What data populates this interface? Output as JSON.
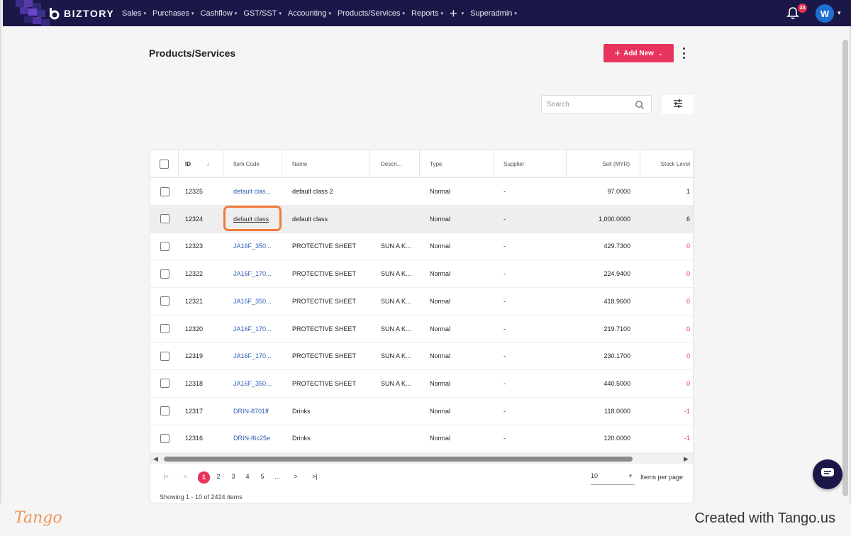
{
  "app": {
    "brand": "BIZTORY",
    "menu": [
      {
        "label": "Sales"
      },
      {
        "label": "Purchases"
      },
      {
        "label": "Cashflow"
      },
      {
        "label": "GST/SST"
      },
      {
        "label": "Accounting"
      },
      {
        "label": "Products/Services"
      },
      {
        "label": "Reports"
      }
    ],
    "plus_label": "+",
    "superadmin": "Superadmin",
    "notification_count": "24",
    "avatar_initial": "W",
    "accent_color": "#e8345c",
    "nav_color": "#1b1849"
  },
  "page": {
    "title": "Products/Services",
    "add_button": "Add New",
    "search_placeholder": "Search"
  },
  "table": {
    "headers": {
      "id": "ID",
      "item_code": "Item Code",
      "name": "Name",
      "description": "Descri...",
      "type": "Type",
      "supplier": "Supplier",
      "sell": "Sell (MYR)",
      "stock": "Stock Level"
    },
    "rows": [
      {
        "id": "12325",
        "item_code": "default clas...",
        "name": "default class 2",
        "description": "",
        "type": "Normal",
        "supplier": "-",
        "sell": "97.0000",
        "stock": "1",
        "negative": false,
        "highlight": false
      },
      {
        "id": "12324",
        "item_code": "default class",
        "name": "default class",
        "description": "",
        "type": "Normal",
        "supplier": "-",
        "sell": "1,000.0000",
        "stock": "6",
        "negative": false,
        "highlight": true
      },
      {
        "id": "12323",
        "item_code": "JA16F_350...",
        "name": "PROTECTIVE SHEET",
        "description": "SUN A K...",
        "type": "Normal",
        "supplier": "-",
        "sell": "429.7300",
        "stock": "0",
        "negative": true,
        "highlight": false
      },
      {
        "id": "12322",
        "item_code": "JA16F_170...",
        "name": "PROTECTIVE SHEET",
        "description": "SUN A K...",
        "type": "Normal",
        "supplier": "-",
        "sell": "224.9400",
        "stock": "0",
        "negative": true,
        "highlight": false
      },
      {
        "id": "12321",
        "item_code": "JA16F_350...",
        "name": "PROTECTIVE SHEET",
        "description": "SUN A K...",
        "type": "Normal",
        "supplier": "-",
        "sell": "418.9600",
        "stock": "0",
        "negative": true,
        "highlight": false
      },
      {
        "id": "12320",
        "item_code": "JA16F_170...",
        "name": "PROTECTIVE SHEET",
        "description": "SUN A K...",
        "type": "Normal",
        "supplier": "-",
        "sell": "219.7100",
        "stock": "0",
        "negative": true,
        "highlight": false
      },
      {
        "id": "12319",
        "item_code": "JA16F_170...",
        "name": "PROTECTIVE SHEET",
        "description": "SUN A K...",
        "type": "Normal",
        "supplier": "-",
        "sell": "230.1700",
        "stock": "0",
        "negative": true,
        "highlight": false
      },
      {
        "id": "12318",
        "item_code": "JA16F_350...",
        "name": "PROTECTIVE SHEET",
        "description": "SUN A K...",
        "type": "Normal",
        "supplier": "-",
        "sell": "440.5000",
        "stock": "0",
        "negative": true,
        "highlight": false
      },
      {
        "id": "12317",
        "item_code": "DRIN-8701ff",
        "name": "Drinks",
        "description": "",
        "type": "Normal",
        "supplier": "-",
        "sell": "118.0000",
        "stock": "-1",
        "negative": true,
        "highlight": false
      },
      {
        "id": "12316",
        "item_code": "DRIN-f6c25e",
        "name": "Drinks",
        "description": "",
        "type": "Normal",
        "supplier": "-",
        "sell": "120.0000",
        "stock": "-1",
        "negative": true,
        "highlight": false
      }
    ]
  },
  "pagination": {
    "pages": [
      "1",
      "2",
      "3",
      "4",
      "5",
      "..."
    ],
    "current_page": "1",
    "first": "|<",
    "prev": "<",
    "next": ">",
    "last": ">|",
    "per_page": "10",
    "per_page_label": "Items per page",
    "showing": "Showing 1 - 10 of 2424 items"
  },
  "footer": {
    "logo": "Tango",
    "credit": "Created with Tango.us"
  }
}
